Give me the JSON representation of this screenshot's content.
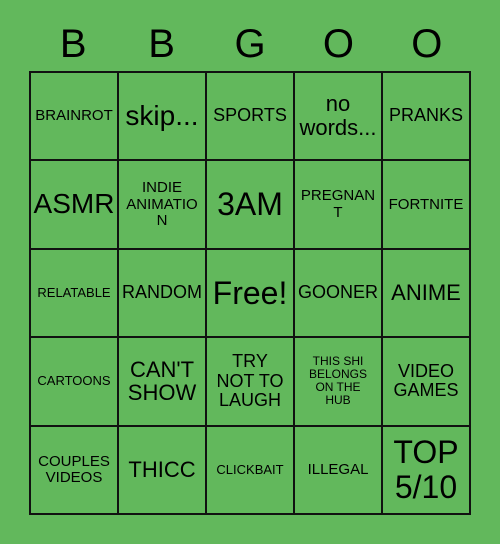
{
  "card": {
    "title": "Bingo Card",
    "background_color": "#62b85c",
    "cell_border_color": "#111111",
    "text_color": "#000000",
    "header_letters": [
      "B",
      "B",
      "G",
      "O",
      "O"
    ],
    "columns": 5,
    "rows": 5,
    "free_space": {
      "row": 3,
      "column": 3,
      "label": "Free!"
    },
    "cells": [
      {
        "label": "BRAINROT",
        "size": "sm"
      },
      {
        "label": "skip...",
        "size": "xl"
      },
      {
        "label": "SPORTS",
        "size": "md"
      },
      {
        "label": "no\nwords...",
        "size": "lg"
      },
      {
        "label": "PRANKS",
        "size": "md"
      },
      {
        "label": "ASMR",
        "size": "xl"
      },
      {
        "label": "INDIE\nANIMATION",
        "size": "sm"
      },
      {
        "label": "3AM",
        "size": "xxl"
      },
      {
        "label": "PREGNANT",
        "size": "sm"
      },
      {
        "label": "FORTNITE",
        "size": "sm"
      },
      {
        "label": "RELATABLE",
        "size": "xs"
      },
      {
        "label": "RANDOM",
        "size": "md"
      },
      {
        "label": "Free!",
        "size": "xxl"
      },
      {
        "label": "GOONER",
        "size": "md"
      },
      {
        "label": "ANIME",
        "size": "lg"
      },
      {
        "label": "CARTOONS",
        "size": "xs"
      },
      {
        "label": "CAN'T\nSHOW",
        "size": "lg"
      },
      {
        "label": "TRY\nNOT TO\nLAUGH",
        "size": "md"
      },
      {
        "label": "THIS SHI\nBELONGS\nON THE\nHUB",
        "size": "xxs"
      },
      {
        "label": "VIDEO\nGAMES",
        "size": "md"
      },
      {
        "label": "COUPLES\nVIDEOS",
        "size": "sm"
      },
      {
        "label": "THICC",
        "size": "lg"
      },
      {
        "label": "CLICKBAIT",
        "size": "xs"
      },
      {
        "label": "ILLEGAL",
        "size": "sm"
      },
      {
        "label": "TOP\n5/10",
        "size": "xxl"
      }
    ]
  }
}
